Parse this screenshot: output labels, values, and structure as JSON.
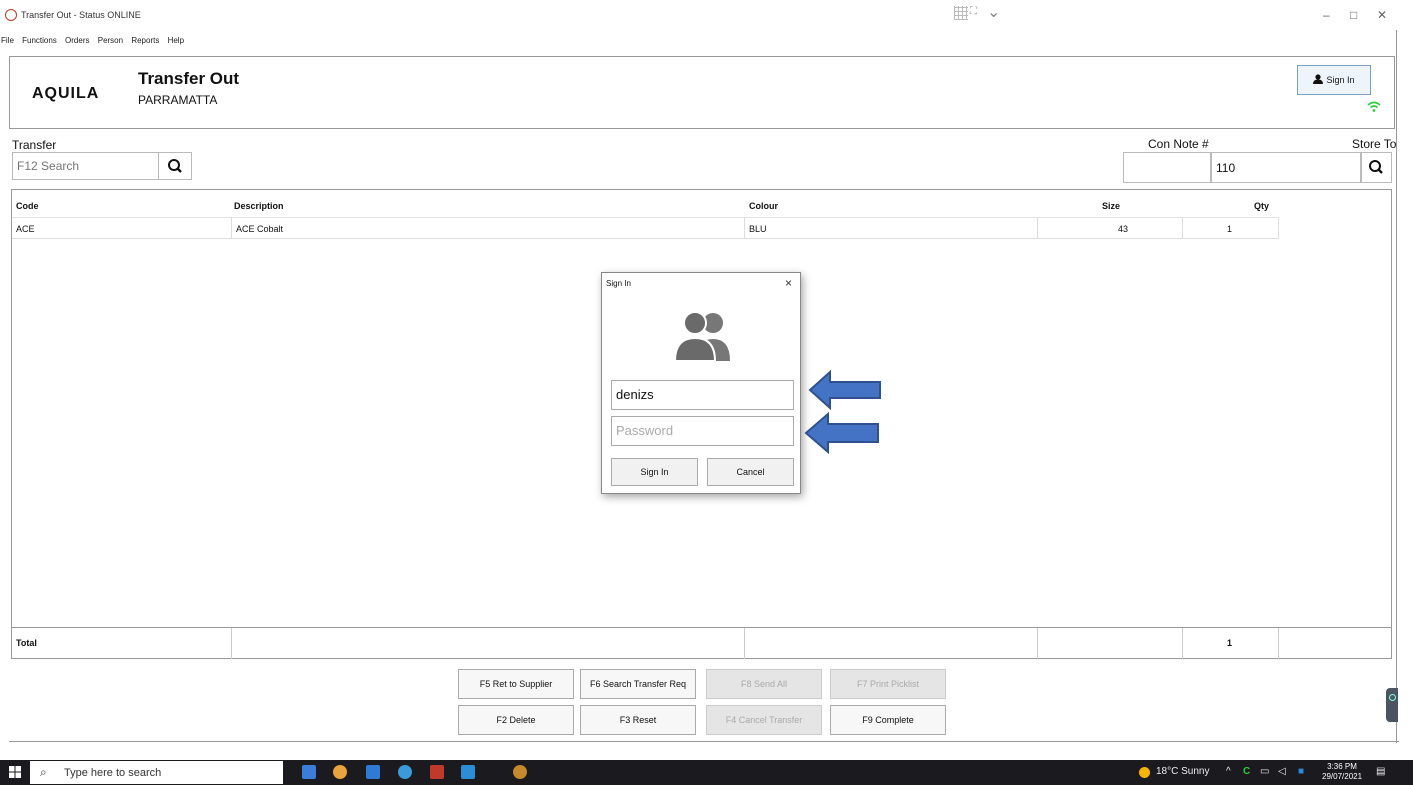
{
  "window": {
    "title": "Transfer Out - Status ONLINE",
    "minimize": "–",
    "maximize": "□",
    "close": "✕"
  },
  "menu": [
    "File",
    "Functions",
    "Orders",
    "Person",
    "Reports",
    "Help"
  ],
  "header": {
    "logo": "AQUILA",
    "title": "Transfer Out",
    "branch": "PARRAMATTA",
    "sign_in_label": "Sign In"
  },
  "transfer": {
    "label": "Transfer",
    "search_placeholder": "F12 Search",
    "con_note_label": "Con Note #",
    "con_note_value": "",
    "store_to_label": "Store To",
    "store_to_value": "110"
  },
  "grid": {
    "columns": [
      "Code",
      "Description",
      "Colour",
      "Size",
      "Qty"
    ],
    "rows": [
      {
        "code": "ACE",
        "description": "ACE Cobalt",
        "colour": "BLU",
        "size": "43",
        "qty": "1"
      }
    ],
    "total_label": "Total",
    "total_qty": "1"
  },
  "actions": {
    "row1": [
      "F5 Ret to Supplier",
      "F6 Search Transfer Req",
      "F8 Send All",
      "F7 Print Picklist"
    ],
    "row2": [
      "F2 Delete",
      "F3 Reset",
      "F4 Cancel Transfer",
      "F9 Complete"
    ]
  },
  "dialog": {
    "title": "Sign In",
    "close": "×",
    "username_value": "denizs",
    "password_placeholder": "Password",
    "sign_in_button": "Sign In",
    "cancel_button": "Cancel"
  },
  "taskbar": {
    "search_placeholder": "Type here to search",
    "weather": "18°C  Sunny",
    "time": "3:36 PM",
    "date": "29/07/2021"
  },
  "colors": {
    "arrow_fill": "#4472c4",
    "arrow_stroke": "#2f528f",
    "wifi": "#2ecc40",
    "taskbar": "#1a1a1f"
  }
}
